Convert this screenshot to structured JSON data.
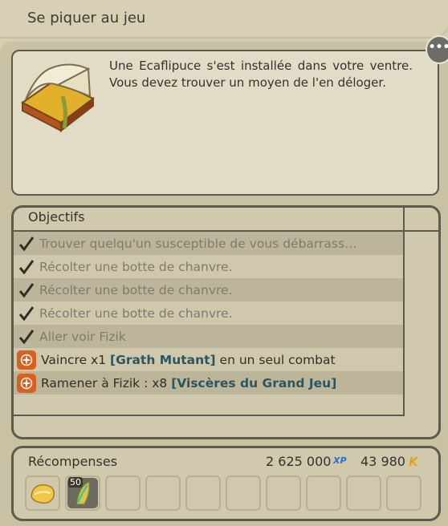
{
  "header": {
    "title": "Se piquer au jeu"
  },
  "description": {
    "text": "Une Ecaflipuce s'est installée dans votre ventre. Vous devez trouver un moyen de l'en déloger.",
    "icon": "quest-book-icon"
  },
  "objectives": {
    "header": "Objectifs",
    "items": [
      {
        "status": "done",
        "text": "Trouver quelqu'un susceptible de vous débarrass…",
        "highlight": "",
        "suffix": ""
      },
      {
        "status": "done",
        "text": "Récolter une botte de chanvre.",
        "highlight": "",
        "suffix": ""
      },
      {
        "status": "done",
        "text": "Récolter une botte de chanvre.",
        "highlight": "",
        "suffix": ""
      },
      {
        "status": "done",
        "text": "Récolter une botte de chanvre.",
        "highlight": "",
        "suffix": ""
      },
      {
        "status": "done",
        "text": "Aller voir Fizik",
        "highlight": "",
        "suffix": ""
      },
      {
        "status": "active",
        "text": "Vaincre x1 ",
        "highlight": "[Grath Mutant]",
        "suffix": " en un seul combat"
      },
      {
        "status": "active",
        "text": "Ramener à Fizik : x8 ",
        "highlight": "[Viscères du Grand Jeu]",
        "suffix": ""
      }
    ]
  },
  "rewards": {
    "label": "Récompenses",
    "xp": "2 625 000",
    "xp_badge": "XP",
    "kamas": "43 980",
    "kamas_badge": "K",
    "items": [
      {
        "icon": "fortune-cookie-icon",
        "level": ""
      },
      {
        "icon": "equipment-item-icon",
        "level": "50"
      }
    ],
    "empty_slots": 8
  },
  "colors": {
    "accent_active": "#d9601f",
    "item_link": "#2c5560",
    "done_text": "#7f7b6c"
  }
}
